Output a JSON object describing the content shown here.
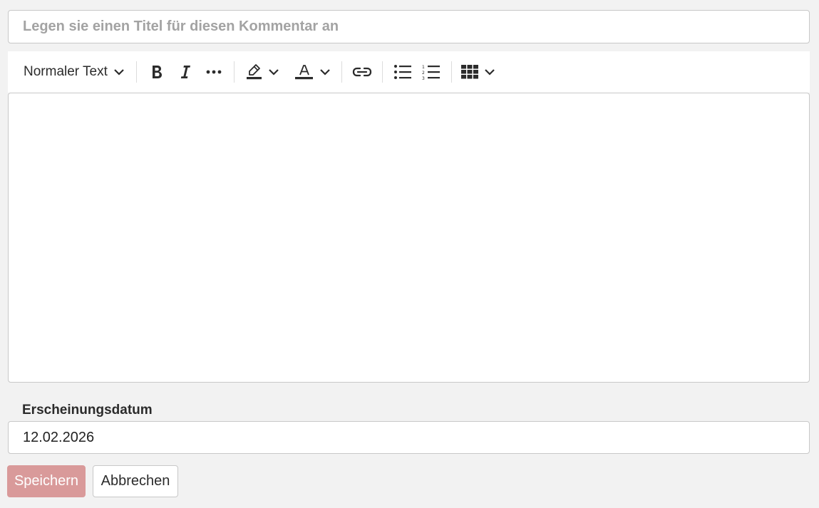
{
  "title_field": {
    "placeholder": "Legen sie einen Titel für diesen Kommentar an",
    "value": ""
  },
  "toolbar": {
    "heading_label": "Normaler Text",
    "icons": [
      "bold-icon",
      "italic-icon",
      "more-icon",
      "highlight-icon",
      "font-color-icon",
      "link-icon",
      "bulleted-list-icon",
      "numbered-list-icon",
      "table-icon"
    ]
  },
  "date": {
    "label": "Erscheinungsdatum",
    "value": "12.02.2026"
  },
  "actions": {
    "save_label": "Speichern",
    "cancel_label": "Abbrechen"
  },
  "colors": {
    "save_button": "#d99a9a",
    "background": "#f2f2f2"
  }
}
